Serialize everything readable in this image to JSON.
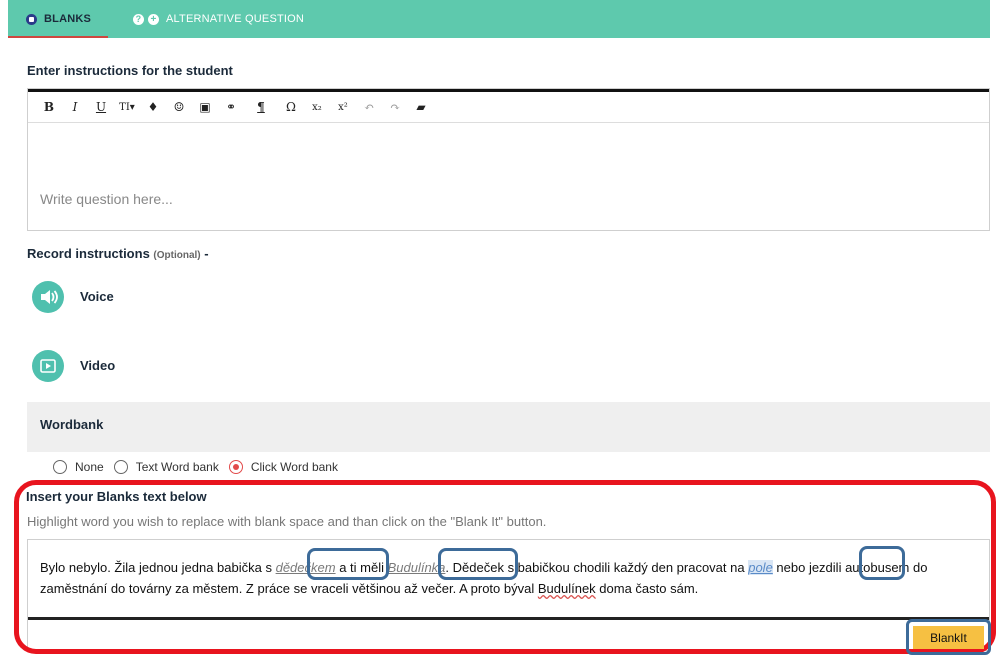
{
  "tabs": {
    "blanks_label": "BLANKS",
    "alt_label": "ALTERNATIVE QUESTION"
  },
  "instructions": {
    "title": "Enter instructions for the student",
    "placeholder": "Write question here...",
    "toolbar": [
      "B",
      "I",
      "U",
      "TI▾",
      "♦",
      "☺",
      "▣",
      "⚭",
      "¶",
      "Ω",
      "x₂",
      "x²",
      "↶",
      "↷",
      "▰"
    ]
  },
  "record": {
    "title": "Record instructions",
    "optional": "(Optional)",
    "dash": "-",
    "voice_label": "Voice",
    "video_label": "Video"
  },
  "wordbank": {
    "title": "Wordbank",
    "options": [
      "None",
      "Text Word bank",
      "Click Word bank"
    ],
    "selected": "Click Word bank"
  },
  "blanks": {
    "title": "Insert your Blanks text below",
    "subtitle": "Highlight word you wish to replace with blank space and than click on the \"Blank It\" button.",
    "text_segments": {
      "s1": "Bylo nebylo. Žila jednou jedna babička s ",
      "w1": "dědečkem",
      "s2": " a ti měli ",
      "w2": "Budulínka",
      "s3": ". Dědeček s babičkou chodili každý den pracovat na ",
      "w3": "pole",
      "s4": " nebo jezdili autobusem do zaměstnání do továrny za městem. Z práce se vraceli většinou až večer. A proto býval ",
      "w4": "Budulínek",
      "s5": " doma často sám."
    },
    "button_label": "BlankIt"
  },
  "colors": {
    "tabbar": "#5ec9ad",
    "accent_red": "#e8141e",
    "button": "#f6c042",
    "box_blue": "#3d6b99"
  }
}
